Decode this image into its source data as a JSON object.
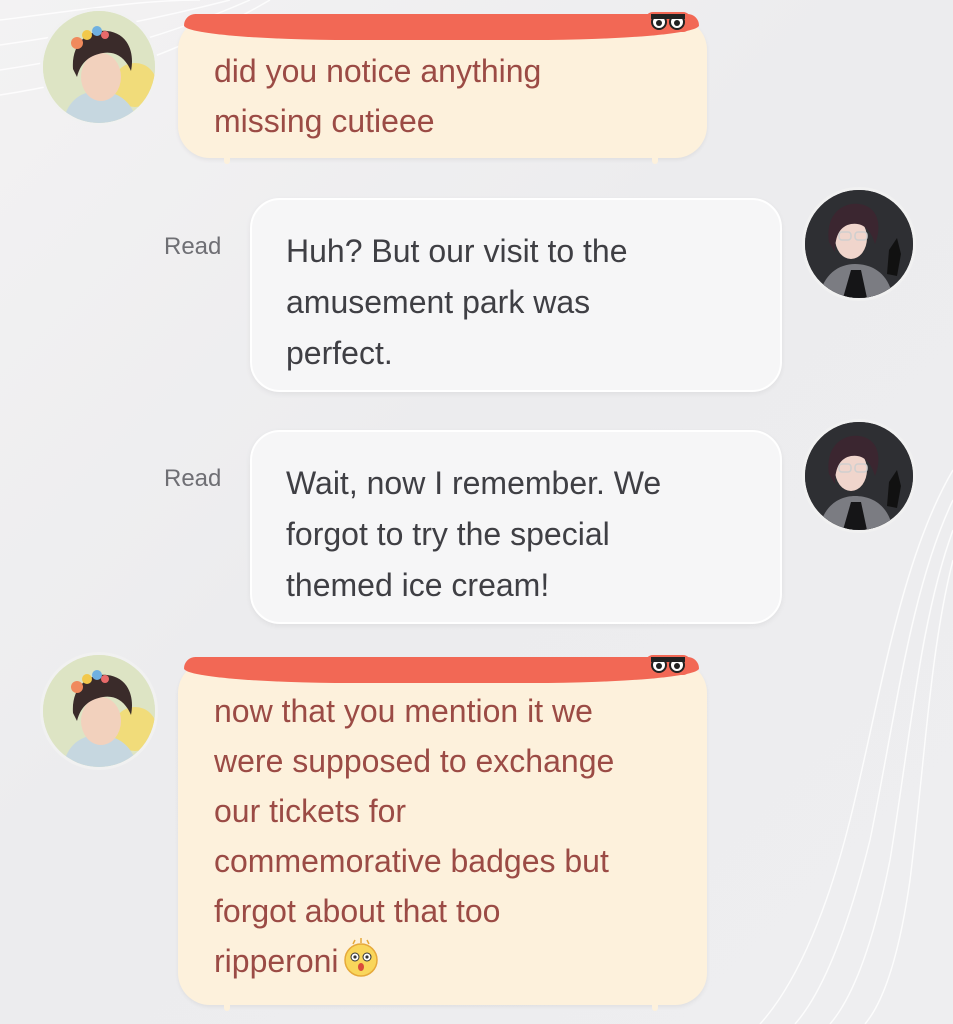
{
  "messages": [
    {
      "sender": "other",
      "lines": [
        "did you notice anything",
        "missing cutieee"
      ]
    },
    {
      "sender": "self",
      "status": "Read",
      "lines": [
        "Huh? But our visit to the",
        "amusement park was",
        "perfect."
      ]
    },
    {
      "sender": "self",
      "status": "Read",
      "lines": [
        "Wait, now I remember. We",
        "forgot to try the special",
        "themed ice cream!"
      ]
    },
    {
      "sender": "other",
      "lines": [
        "now that you mention it we",
        "were supposed to exchange",
        "our tickets for",
        "commemorative badges but",
        "forgot about that too",
        "ripperoni"
      ],
      "emoji": "surprised-face-emoji"
    }
  ],
  "colors": {
    "incoming_bubble": "#fdf1dc",
    "incoming_header": "#f26855",
    "incoming_text": "#9b4b45",
    "outgoing_bubble": "#f6f6f7",
    "outgoing_text": "#3f3f44",
    "status_text": "#6f6f74"
  }
}
